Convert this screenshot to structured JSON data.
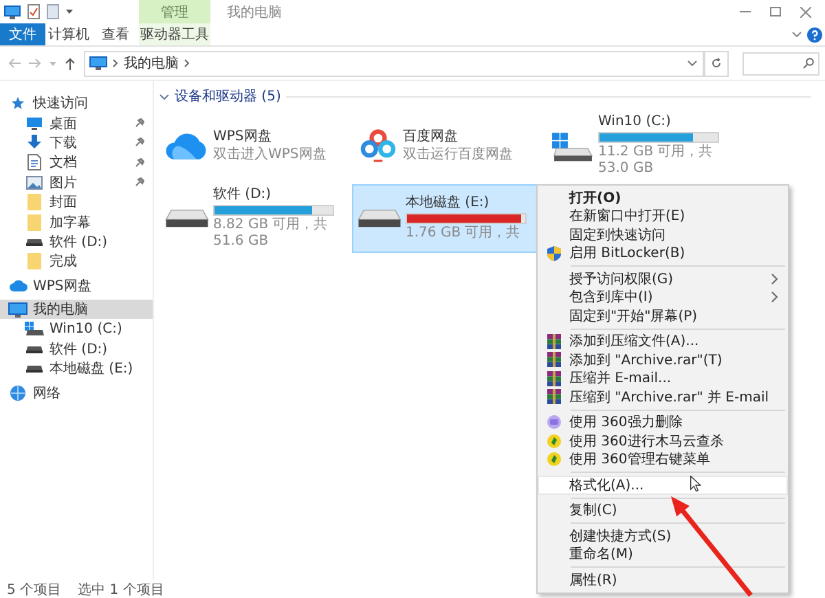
{
  "window": {
    "title": "我的电脑",
    "context_tab": "管理"
  },
  "ribbon": {
    "tabs": [
      {
        "label": "文件",
        "kind": "file",
        "selected": false
      },
      {
        "label": "计算机",
        "kind": "normal",
        "selected": false
      },
      {
        "label": "查看",
        "kind": "normal",
        "selected": false
      },
      {
        "label": "驱动器工具",
        "kind": "contextual",
        "selected": false
      }
    ]
  },
  "address": {
    "path": [
      "我的电脑"
    ]
  },
  "sidebar": {
    "items": [
      {
        "kind": "star",
        "label": "快速访问",
        "selected": false,
        "children": [
          {
            "kind": "desktop",
            "label": "桌面",
            "pinned": true,
            "selected": false
          },
          {
            "kind": "download",
            "label": "下载",
            "pinned": true,
            "selected": false
          },
          {
            "kind": "document",
            "label": "文档",
            "pinned": true,
            "selected": false
          },
          {
            "kind": "picture",
            "label": "图片",
            "pinned": true,
            "selected": false
          },
          {
            "kind": "folder",
            "label": "封面",
            "pinned": false,
            "selected": false
          },
          {
            "kind": "folder",
            "label": "加字幕",
            "pinned": false,
            "selected": false
          },
          {
            "kind": "drive",
            "label": "软件 (D:)",
            "pinned": false,
            "selected": false
          },
          {
            "kind": "folder",
            "label": "完成",
            "pinned": false,
            "selected": false
          }
        ]
      },
      {
        "kind": "cloud",
        "label": "WPS网盘",
        "selected": false
      },
      {
        "kind": "computer",
        "label": "我的电脑",
        "selected": true,
        "children": [
          {
            "kind": "windows",
            "label": "Win10 (C:)",
            "selected": false
          },
          {
            "kind": "drive",
            "label": "软件 (D:)",
            "selected": false
          },
          {
            "kind": "drive",
            "label": "本地磁盘 (E:)",
            "selected": false
          }
        ]
      },
      {
        "kind": "network",
        "label": "网络",
        "selected": false
      }
    ]
  },
  "content": {
    "group": {
      "title": "设备和驱动器 (5)",
      "expanded": true
    },
    "drives": [
      {
        "kind": "cloud",
        "name": "WPS网盘",
        "subtitle": "双击进入WPS网盘",
        "selected": false
      },
      {
        "kind": "baidu",
        "name": "百度网盘",
        "subtitle": "双击运行百度网盘",
        "selected": false
      },
      {
        "kind": "windows",
        "name": "Win10 (C:)",
        "level": 0.79,
        "free": "11.2 GB 可用，共 53.0 GB",
        "selected": false
      },
      {
        "kind": "drive",
        "name": "软件 (D:)",
        "level": 0.83,
        "free": "8.82 GB 可用，共 51.6 GB",
        "selected": false
      },
      {
        "kind": "drive",
        "name": "本地磁盘 (E:)",
        "level": 0.97,
        "free": "1.76 GB 可用，共",
        "selected": true
      }
    ]
  },
  "context_menu": {
    "items": [
      {
        "kind": "plain",
        "label": "打开(O)",
        "default": true,
        "submenu": false,
        "selected": false
      },
      {
        "kind": "plain",
        "label": "在新窗口中打开(E)",
        "default": false,
        "submenu": false,
        "selected": false
      },
      {
        "kind": "plain",
        "label": "固定到快速访问",
        "default": false,
        "submenu": false,
        "selected": false
      },
      {
        "kind": "shield",
        "label": "启用 BitLocker(B)",
        "default": false,
        "submenu": false,
        "selected": false
      },
      {
        "kind": "separator"
      },
      {
        "kind": "plain",
        "label": "授予访问权限(G)",
        "default": false,
        "submenu": true,
        "selected": false
      },
      {
        "kind": "plain",
        "label": "包含到库中(I)",
        "default": false,
        "submenu": true,
        "selected": false
      },
      {
        "kind": "plain",
        "label": "固定到\"开始\"屏幕(P)",
        "default": false,
        "submenu": false,
        "selected": false
      },
      {
        "kind": "separator"
      },
      {
        "kind": "archive",
        "label": "添加到压缩文件(A)...",
        "default": false,
        "submenu": false,
        "selected": false
      },
      {
        "kind": "archive",
        "label": "添加到 \"Archive.rar\"(T)",
        "default": false,
        "submenu": false,
        "selected": false
      },
      {
        "kind": "archive",
        "label": "压缩并 E-mail...",
        "default": false,
        "submenu": false,
        "selected": false
      },
      {
        "kind": "archive",
        "label": "压缩到 \"Archive.rar\" 并 E-mail",
        "default": false,
        "submenu": false,
        "selected": false
      },
      {
        "kind": "separator"
      },
      {
        "kind": "eraser",
        "label": "使用 360强力删除",
        "default": false,
        "submenu": false,
        "selected": false
      },
      {
        "kind": "guard",
        "label": "使用 360进行木马云查杀",
        "default": false,
        "submenu": false,
        "selected": false
      },
      {
        "kind": "guard",
        "label": "使用 360管理右键菜单",
        "default": false,
        "submenu": false,
        "selected": false
      },
      {
        "kind": "separator"
      },
      {
        "kind": "plain",
        "label": "格式化(A)...",
        "default": false,
        "submenu": false,
        "selected": true
      },
      {
        "kind": "separator"
      },
      {
        "kind": "plain",
        "label": "复制(C)",
        "default": false,
        "submenu": false,
        "selected": false
      },
      {
        "kind": "separator"
      },
      {
        "kind": "plain",
        "label": "创建快捷方式(S)",
        "default": false,
        "submenu": false,
        "selected": false
      },
      {
        "kind": "plain",
        "label": "重命名(M)",
        "default": false,
        "submenu": false,
        "selected": false
      },
      {
        "kind": "separator"
      },
      {
        "kind": "plain",
        "label": "属性(R)",
        "default": false,
        "submenu": false,
        "selected": false
      }
    ]
  },
  "status_bar": {
    "item_count": "5 个项目",
    "selection": "选中 1 个项目"
  }
}
